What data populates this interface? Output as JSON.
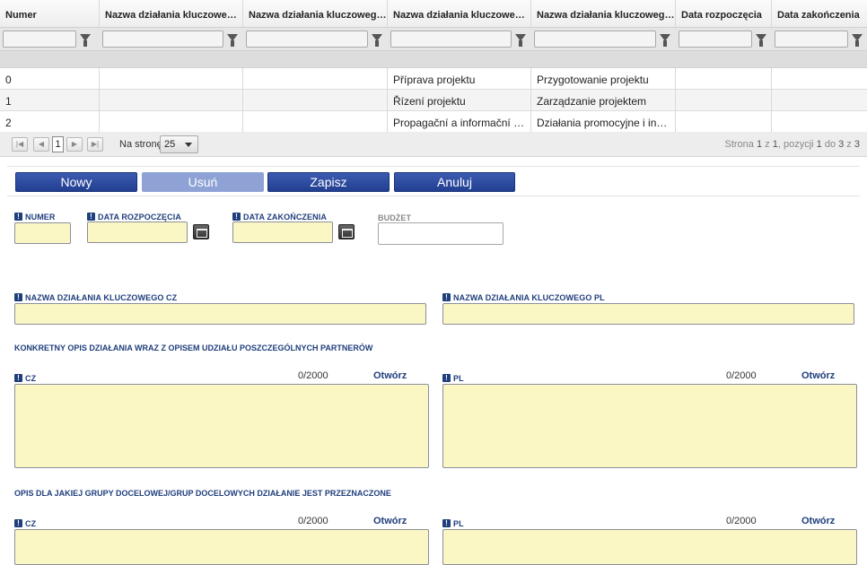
{
  "grid": {
    "columns": [
      "Numer",
      "Nazwa działania kluczowego CZ",
      "Nazwa działania kluczowego PL",
      "Nazwa działania kluczowego CZ",
      "Nazwa działania kluczowego PL",
      "Data rozpoczęcia",
      "Data zakończenia"
    ],
    "rows": [
      [
        "0",
        "",
        "",
        "Příprava projektu",
        "Przygotowanie projektu",
        "",
        ""
      ],
      [
        "1",
        "",
        "",
        "Řízení projektu",
        "Zarządzanie projektem",
        "",
        ""
      ],
      [
        "2",
        "",
        "",
        "Propagační a informační čin...",
        "Działania promocyjne i infor...",
        "",
        ""
      ]
    ]
  },
  "pager": {
    "current_page": "1",
    "per_page_label": "Na stronę",
    "per_page_value": "25",
    "info_prefix": "Strona ",
    "page": "1",
    "of": " z ",
    "pages": "1",
    "items_prefix": ", pozycji ",
    "from": "1",
    "to_label": " do ",
    "to": "3",
    "of2": " z ",
    "total": "3"
  },
  "toolbar": {
    "new_label": "Nowy",
    "delete_label": "Usuń",
    "save_label": "Zapisz",
    "cancel_label": "Anuluj"
  },
  "form": {
    "numer_label": "Numer",
    "start_label": "Data rozpoczęcia",
    "end_label": "Data zakończenia",
    "budget_label": "Budżet",
    "name_cz_label": "Nazwa działania kluczowego CZ",
    "name_pl_label": "Nazwa działania kluczowego PL",
    "desc_section": "Konkretny opis działania wraz z opisem udziału poszczególnych partnerów",
    "target_section": "Opis dla jakiej grupy docelowej/grup docelowych działanie jest przeznaczone",
    "cz_label": "CZ",
    "pl_label": "PL",
    "counter": "0/2000",
    "open_label": "Otwórz"
  },
  "colors": {
    "required_field": "#fbf7c5",
    "primary_button": "#223f91",
    "label_blue": "#1f3e7c"
  }
}
